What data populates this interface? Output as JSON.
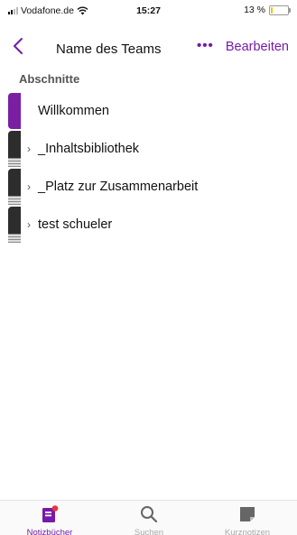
{
  "status_bar": {
    "carrier": "Vodafone.de",
    "time": "15:27",
    "battery": "13 %",
    "battery_level": 0.13
  },
  "nav": {
    "title": "Name des Teams",
    "more": "•••",
    "edit": "Bearbeiten"
  },
  "section_header": "Abschnitte",
  "sections": [
    {
      "label": "Willkommen",
      "chevron": "",
      "color": "#7b1fa2"
    },
    {
      "label": "_Inhaltsbibliothek",
      "chevron": "›",
      "color": "#2d2d2d"
    },
    {
      "label": "_Platz zur Zusammenarbeit",
      "chevron": "›",
      "color": "#2d2d2d"
    },
    {
      "label": "test schueler",
      "chevron": "›",
      "color": "#2d2d2d"
    }
  ],
  "tabbar": {
    "items": [
      {
        "label": "Notizbücher",
        "icon": "notebook-icon",
        "active": true
      },
      {
        "label": "Suchen",
        "icon": "search-icon",
        "active": false
      },
      {
        "label": "Kurznotizen",
        "icon": "sticky-note-icon",
        "active": false
      }
    ]
  },
  "colors": {
    "accent": "#7719aa",
    "section_purple": "#7b1fa2",
    "section_dark": "#2d2d2d"
  }
}
